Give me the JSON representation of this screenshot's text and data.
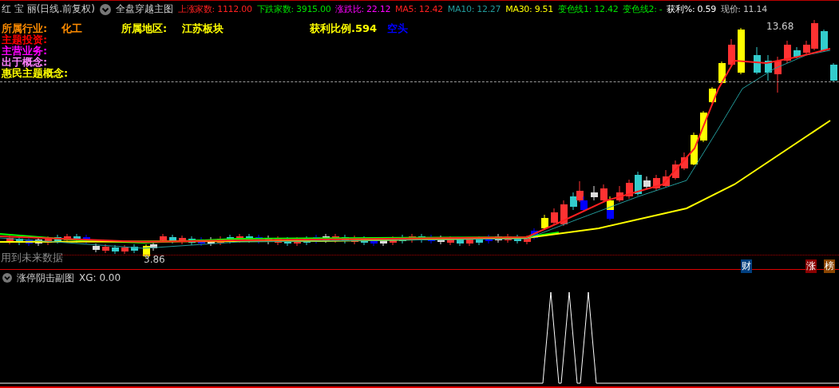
{
  "header": {
    "stock": "红 宝 丽(日线.前复权)",
    "indicator": "全盘穿越主图",
    "stats": [
      {
        "text": "上涨家数: 1112.00",
        "color": "#ff2020"
      },
      {
        "text": "下跌家数: 3915.00",
        "color": "#00e000"
      },
      {
        "text": "涨跌比: 22.12",
        "color": "#ff00ff"
      },
      {
        "text": "MA5: 12.42",
        "color": "#ff2020"
      },
      {
        "text": "MA10: 12.27",
        "color": "#229999"
      },
      {
        "text": "MA30: 9.51",
        "color": "#ffff00"
      },
      {
        "text": "变色线1: 12.42",
        "color": "#00e000"
      },
      {
        "text": "变色线2: -",
        "color": "#00e000"
      },
      {
        "text": "获利%: 0.59",
        "color": "#ffffff"
      },
      {
        "text": "现价: 11.14",
        "color": "#c0c0c0"
      }
    ]
  },
  "info": {
    "row": [
      {
        "text": "所属行业:",
        "color": "#ff8c00"
      },
      {
        "text": "化工",
        "color": "#ff8c00"
      },
      {
        "text": "所属地区:",
        "color": "#ffff00"
      },
      {
        "text": "江苏板块",
        "color": "#ffff00"
      },
      {
        "text": "获利比例.594",
        "color": "#ffff00"
      },
      {
        "text": "空头",
        "color": "#0000ff"
      }
    ],
    "lines": [
      {
        "text": "主题投资:",
        "color": "#ff0000"
      },
      {
        "text": "主营业务:",
        "color": "#ff00ff"
      },
      {
        "text": "出于概念:",
        "color": "#ff80ff"
      },
      {
        "text": "惠民主题概念:",
        "color": "#ffff00"
      }
    ]
  },
  "chart": {
    "high_label": "13.68",
    "low_label": "3.86",
    "future_note": "用到未来数据",
    "badges": [
      {
        "text": "财",
        "color": "#003f7f"
      },
      {
        "text": "涨",
        "color": "#8b0000"
      },
      {
        "text": "榜",
        "color": "#8b4500"
      }
    ]
  },
  "sub": {
    "title": "涨停阴击副图",
    "value": "XG: 0.00"
  }
}
